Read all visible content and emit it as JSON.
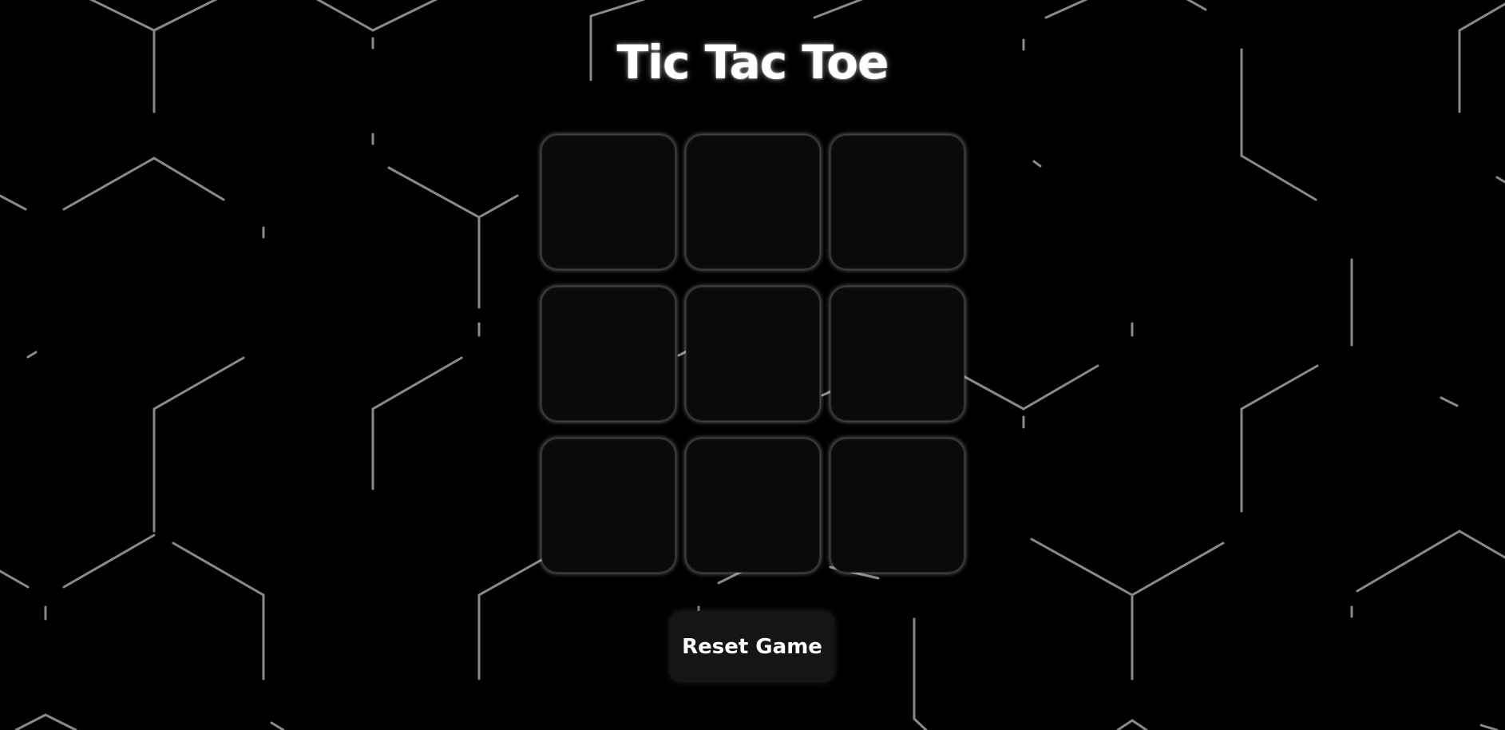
{
  "game": {
    "title": "Tic Tac Toe",
    "board": {
      "cells": [
        "",
        "",
        "",
        "",
        "",
        "",
        "",
        "",
        ""
      ]
    },
    "reset_label": "Reset Game"
  },
  "colors": {
    "background": "#000000",
    "cell_fill": "#0a0a0a",
    "cell_glow": "#d2d2d2",
    "hex_lines": "#8a8a8a",
    "button_fill": "#151515",
    "text": "#ffffff"
  }
}
